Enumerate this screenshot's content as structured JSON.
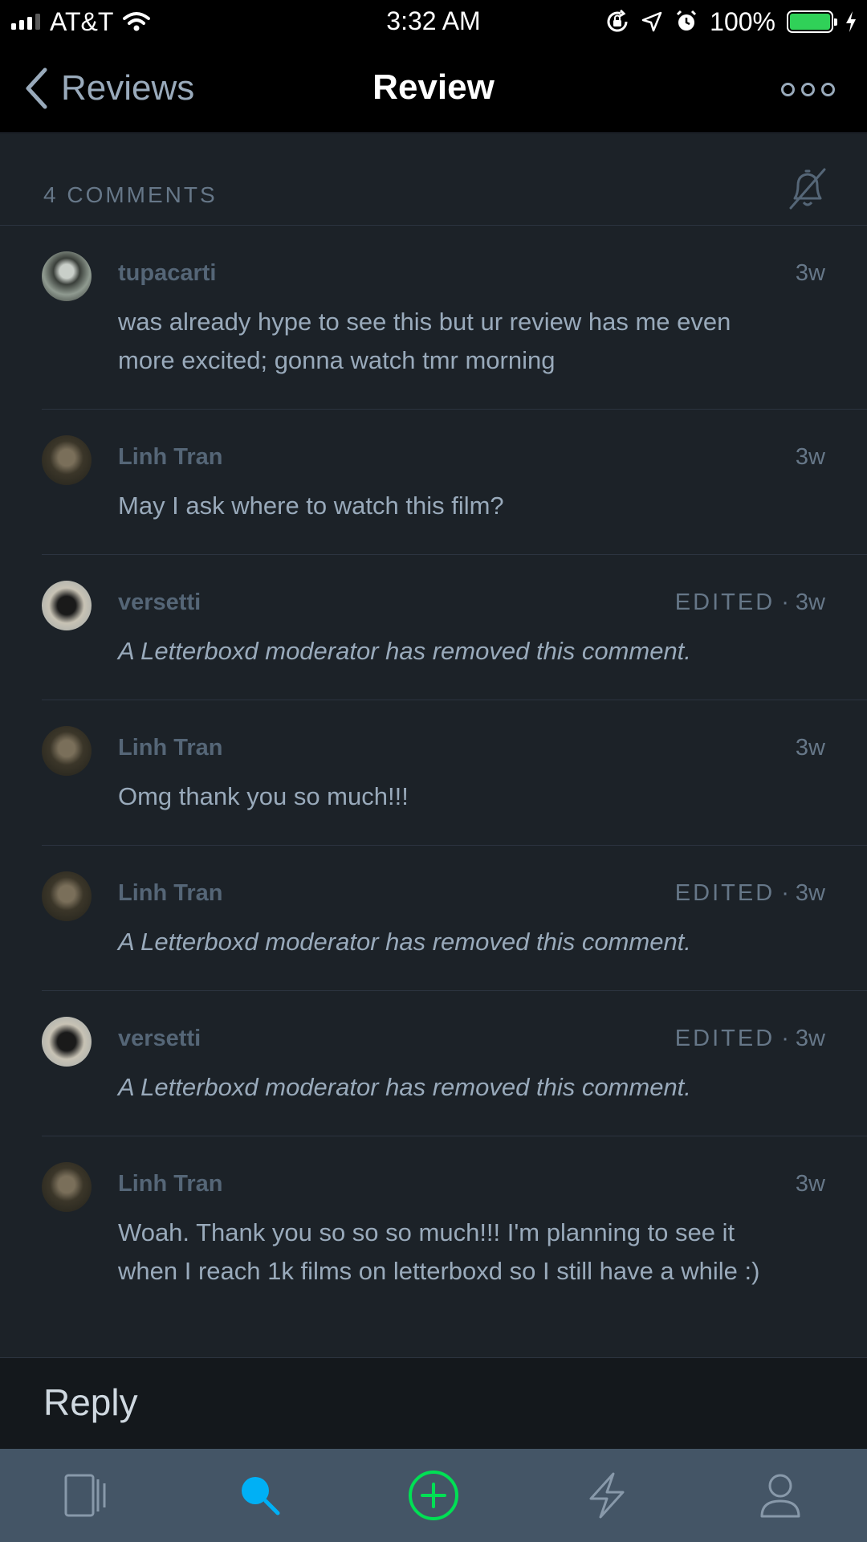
{
  "status_bar": {
    "carrier": "AT&T",
    "time": "3:32 AM",
    "battery_percent": "100%",
    "battery_level": 1.0,
    "battery_color": "#30d158"
  },
  "nav": {
    "back_label": "Reviews",
    "title": "Review"
  },
  "comments_header": {
    "count_label": "4 COMMENTS"
  },
  "comments": [
    {
      "user": "tupacarti",
      "edited": "",
      "time": "3w",
      "text": "was already hype to see this but ur review has me even more excited; gonna watch tmr morning",
      "removed": false
    },
    {
      "user": "Linh Tran",
      "edited": "",
      "time": "3w",
      "text": "May I ask where to watch this film?",
      "removed": false
    },
    {
      "user": "versetti",
      "edited": "EDITED",
      "time": "3w",
      "text": "A Letterboxd moderator has removed this comment.",
      "removed": true
    },
    {
      "user": "Linh Tran",
      "edited": "",
      "time": "3w",
      "text": "Omg thank you so much!!!",
      "removed": false
    },
    {
      "user": "Linh Tran",
      "edited": "EDITED",
      "time": "3w",
      "text": "A Letterboxd moderator has removed this comment.",
      "removed": true
    },
    {
      "user": "versetti",
      "edited": "EDITED",
      "time": "3w",
      "text": "A Letterboxd moderator has removed this comment.",
      "removed": true
    },
    {
      "user": "Linh Tran",
      "edited": "",
      "time": "3w",
      "text": "Woah. Thank you so so so much!!! I'm planning to see it when I reach 1k films on letterboxd so I still have a while :)",
      "removed": false
    }
  ],
  "reply": {
    "placeholder": "Reply"
  },
  "tab_bar": {
    "tabs": [
      "films-icon",
      "search-icon",
      "add-icon",
      "activity-icon",
      "profile-icon"
    ],
    "active_tab": "search-icon"
  },
  "colors": {
    "background": "#1c2228",
    "accent_search": "#00b0f5",
    "accent_add": "#00e054",
    "tab_bar": "#445566"
  }
}
